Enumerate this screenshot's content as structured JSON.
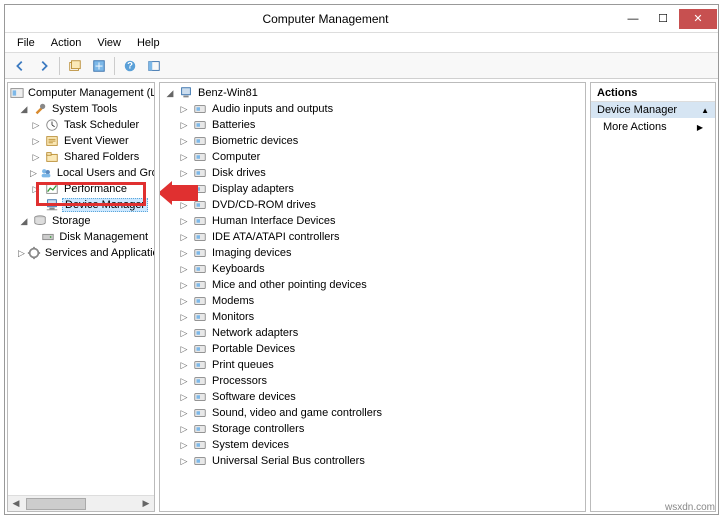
{
  "window": {
    "title": "Computer Management"
  },
  "menu": [
    "File",
    "Action",
    "View",
    "Help"
  ],
  "left_tree": {
    "root": "Computer Management (Local",
    "system_tools": {
      "label": "System Tools",
      "children": [
        "Task Scheduler",
        "Event Viewer",
        "Shared Folders",
        "Local Users and Groups",
        "Performance",
        "Device Manager"
      ]
    },
    "storage": {
      "label": "Storage",
      "children": [
        "Disk Management"
      ]
    },
    "services": "Services and Applications"
  },
  "device_tree": {
    "root": "Benz-Win81",
    "items": [
      "Audio inputs and outputs",
      "Batteries",
      "Biometric devices",
      "Computer",
      "Disk drives",
      "Display adapters",
      "DVD/CD-ROM drives",
      "Human Interface Devices",
      "IDE ATA/ATAPI controllers",
      "Imaging devices",
      "Keyboards",
      "Mice and other pointing devices",
      "Modems",
      "Monitors",
      "Network adapters",
      "Portable Devices",
      "Print queues",
      "Processors",
      "Software devices",
      "Sound, video and game controllers",
      "Storage controllers",
      "System devices",
      "Universal Serial Bus controllers"
    ]
  },
  "actions": {
    "header": "Actions",
    "selected": "Device Manager",
    "more": "More Actions"
  },
  "watermark": "wsxdn.com"
}
